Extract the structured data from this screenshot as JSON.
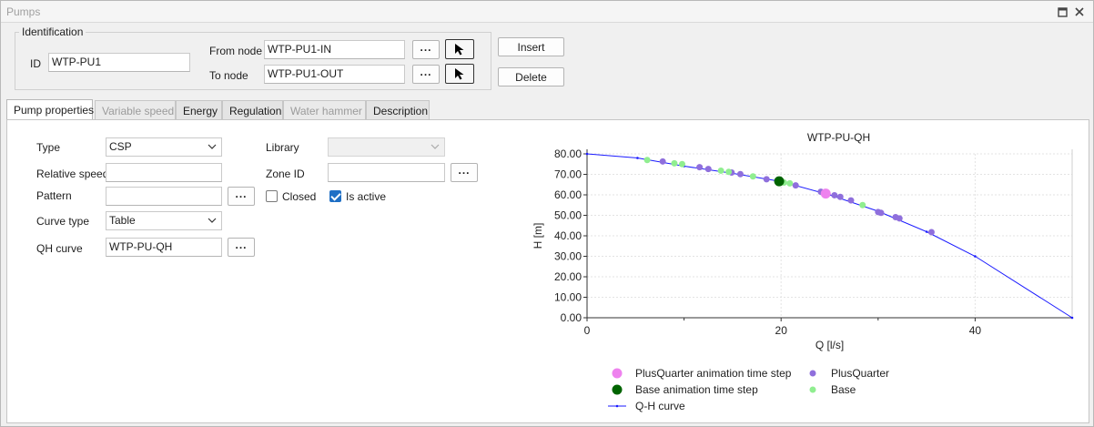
{
  "window": {
    "title": "Pumps",
    "restore_icon": "restore-icon",
    "close_icon": "close-icon"
  },
  "identification": {
    "group_title": "Identification",
    "id_label": "ID",
    "id_value": "WTP-PU1",
    "from_node_label": "From node",
    "from_node_value": "WTP-PU1-IN",
    "to_node_label": "To node",
    "to_node_value": "WTP-PU1-OUT",
    "browse_label": "...",
    "insert_label": "Insert",
    "delete_label": "Delete"
  },
  "tabs": [
    {
      "label": "Pump properties",
      "state": "active"
    },
    {
      "label": "Variable speed",
      "state": "disabled"
    },
    {
      "label": "Energy",
      "state": "normal"
    },
    {
      "label": "Regulation",
      "state": "normal"
    },
    {
      "label": "Water hammer",
      "state": "disabled"
    },
    {
      "label": "Description",
      "state": "normal"
    }
  ],
  "properties": {
    "type_label": "Type",
    "type_value": "CSP",
    "relative_speed_label": "Relative speed",
    "relative_speed_value": "",
    "pattern_label": "Pattern",
    "pattern_value": "",
    "curve_type_label": "Curve type",
    "curve_type_value": "Table",
    "qh_curve_label": "QH curve",
    "qh_curve_value": "WTP-PU-QH",
    "library_label": "Library",
    "library_value": "",
    "zone_id_label": "Zone ID",
    "zone_id_value": "",
    "closed_label": "Closed",
    "closed_checked": false,
    "is_active_label": "Is active",
    "is_active_checked": true,
    "browse_label": "..."
  },
  "colors": {
    "accent": "#1f6fc5",
    "curve": "#1a1aff",
    "plus_quarter": "#8f6fdc",
    "plus_quarter_step": "#ee82ee",
    "base": "#90ee90",
    "base_step": "#006400"
  },
  "chart_data": {
    "type": "scatter",
    "title": "WTP-PU-QH",
    "xlabel": "Q [l/s]",
    "ylabel": "H [m]",
    "xlim": [
      0,
      50
    ],
    "ylim": [
      0,
      80
    ],
    "xticks": [
      "0",
      "20",
      "40"
    ],
    "yticks": [
      "0.00",
      "10.00",
      "20.00",
      "30.00",
      "40.00",
      "50.00",
      "60.00",
      "70.00",
      "80.00"
    ],
    "grid": true,
    "legend_position": "bottom",
    "series": [
      {
        "name": "Q-H curve",
        "kind": "line",
        "x": [
          0,
          5.2,
          10,
          15,
          20,
          25,
          30,
          35,
          40,
          50
        ],
        "y": [
          80,
          78,
          74,
          70.5,
          66.5,
          60,
          52,
          42,
          30,
          0
        ]
      },
      {
        "name": "PlusQuarter",
        "kind": "points",
        "x": [
          7.8,
          11.6,
          12.5,
          14.9,
          15.8,
          18.5,
          21.5,
          24.1,
          25.5,
          26.1,
          27.2,
          30.0,
          30.3,
          31.8,
          32.2,
          35.5
        ],
        "y": [
          76.3,
          73.5,
          72.6,
          70.9,
          70.1,
          67.6,
          64.6,
          61.5,
          59.8,
          59.0,
          57.3,
          51.6,
          51.2,
          49.1,
          48.5,
          41.8
        ]
      },
      {
        "name": "Base",
        "kind": "points",
        "x": [
          6.2,
          9.0,
          9.8,
          13.8,
          14.6,
          17.1,
          20.3,
          20.9,
          28.4
        ],
        "y": [
          77.0,
          75.4,
          75.0,
          71.8,
          71.2,
          69.0,
          66.0,
          65.6,
          55.0
        ]
      },
      {
        "name": "PlusQuarter animation time step",
        "kind": "points",
        "x": [
          24.6
        ],
        "y": [
          60.6
        ]
      },
      {
        "name": "Base animation time step",
        "kind": "points",
        "x": [
          19.8
        ],
        "y": [
          66.6
        ]
      }
    ]
  }
}
